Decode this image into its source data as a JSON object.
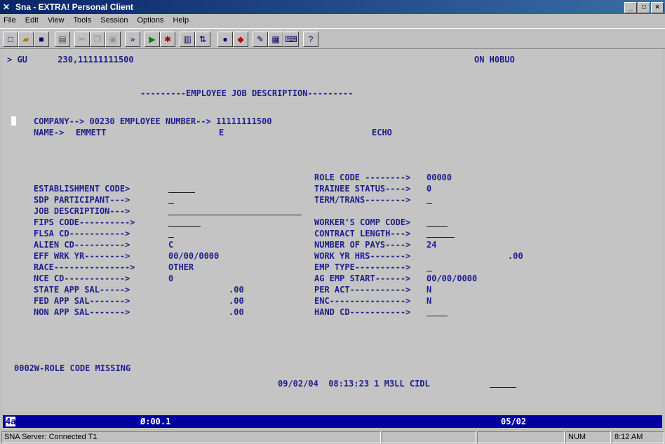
{
  "window": {
    "title": "Sna - EXTRA! Personal Client"
  },
  "menu": [
    "File",
    "Edit",
    "View",
    "Tools",
    "Session",
    "Options",
    "Help"
  ],
  "toolbar_icons": [
    "new-icon",
    "open-icon",
    "save-icon",
    "print-icon",
    "cut-icon",
    "copy-icon",
    "paste-icon",
    "macro-icon",
    "record-icon",
    "settings-icon",
    "session-icon",
    "transfer-icon",
    "dot-icon",
    "connect-icon",
    "edit-icon",
    "display-icon",
    "keyboard-icon",
    "help-icon"
  ],
  "screen": {
    "line1_left": "> GU      230,11111111500",
    "line1_right": "ON H0BUO",
    "heading": "---------EMPLOYEE JOB DESCRIPTION---------",
    "company_line": "COMPANY--> 00230 EMPLOYEE NUMBER--> 11111111500",
    "name_label": "NAME->",
    "first_name": "EMMETT",
    "middle_initial": "E",
    "last_name": "ECHO",
    "left_labels": [
      "ESTABLISHMENT CODE>",
      "SDP PARTICIPANT--->",
      "JOB DESCRIPTION--->",
      "FIPS CODE---------->",
      "FLSA CD----------->",
      "ALIEN CD---------->",
      "EFF WRK YR-------->",
      "RACE--------------->",
      "NCE CD------------>",
      "STATE APP SAL----->",
      "FED APP SAL------->",
      "NON APP SAL------->"
    ],
    "left_values": {
      "alien_cd": "C",
      "eff_wrk_yr": "00/00/0000",
      "race": "OTHER",
      "nce_cd": "0",
      "state_app_sal": ".00",
      "fed_app_sal": ".00",
      "non_app_sal": ".00"
    },
    "right_labels": [
      "ROLE CODE -------->",
      "TRAINEE STATUS---->",
      "TERM/TRANS-------->",
      "WORKER'S COMP CODE>",
      "CONTRACT LENGTH--->",
      "NUMBER OF PAYS---->",
      "WORK YR HRS------->",
      "EMP TYPE---------->",
      "AG EMP START------>",
      "PER ACT----------->",
      "ENC--------------->",
      "HAND CD----------->"
    ],
    "right_values": {
      "role_code": "00000",
      "trainee_status": "0",
      "number_of_pays": "24",
      "work_yr_hrs": ".00",
      "ag_emp_start": "00/00/0000",
      "per_act": "N",
      "enc": "N"
    },
    "message": "0002W-ROLE CODE MISSING",
    "timestamp_line": "09/02/04  08:13:23 1 M3LL CIDL"
  },
  "oia": {
    "left": "4a",
    "center": "Ø:00.1",
    "right": "05/02"
  },
  "statusbar": {
    "connection": "SNA Server: Connected T1",
    "num": "NUM",
    "time": "8:12 AM"
  }
}
